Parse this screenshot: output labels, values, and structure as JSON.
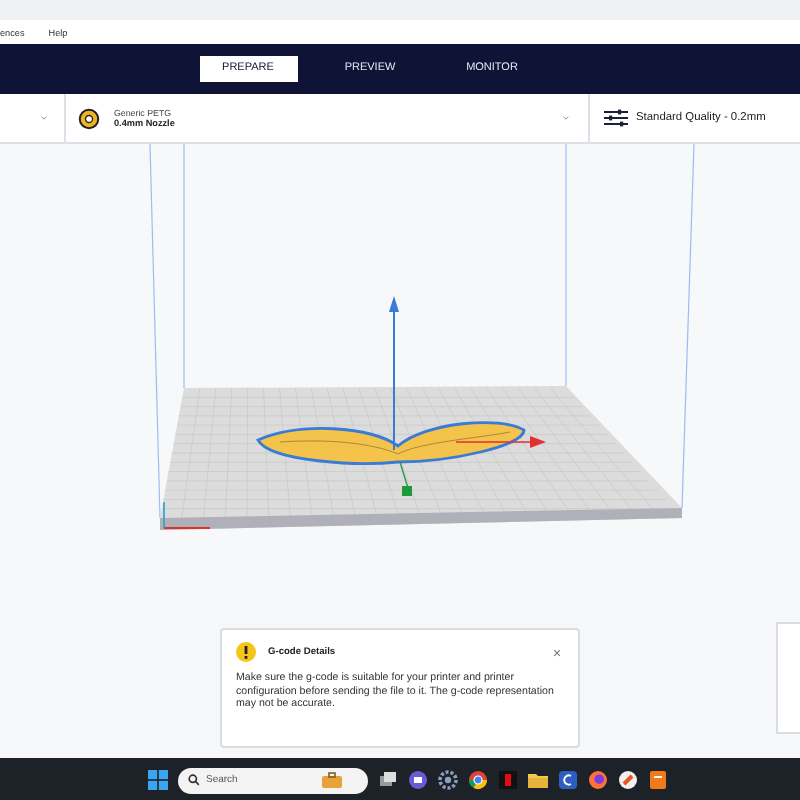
{
  "menu": [
    "ences",
    "Help"
  ],
  "tabs": [
    {
      "label": "PREPARE",
      "selected": true
    },
    {
      "label": "PREVIEW",
      "selected": false
    },
    {
      "label": "MONITOR",
      "selected": false
    }
  ],
  "material": {
    "name": "Generic PETG",
    "nozzle": "0.4mm Nozzle"
  },
  "quality": {
    "label": "Standard Quality - 0.2mm"
  },
  "notification": {
    "title": "G-code Details",
    "message": "Make sure the g-code is suitable for your printer and printer configuration before sending the file to it. The g-code representation may not be accurate."
  },
  "taskbar": {
    "search_placeholder": "Search"
  }
}
